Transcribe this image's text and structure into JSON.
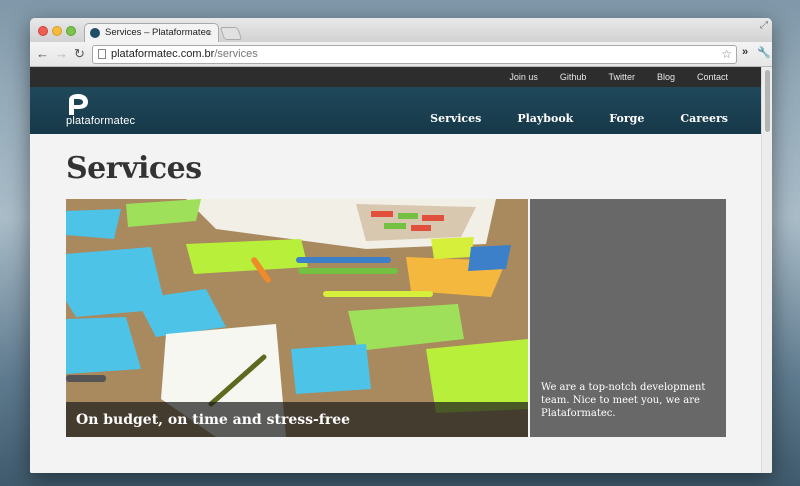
{
  "browser": {
    "tab_title": "Services – Plataformatec",
    "tab_close": "×",
    "url_host": "plataformatec.com.br",
    "url_path": "/services",
    "extensions_label": "»"
  },
  "site": {
    "top_links": [
      "Join us",
      "Github",
      "Twitter",
      "Blog",
      "Contact"
    ],
    "logo_text": "plataformatec",
    "nav_links": [
      "Services",
      "Playbook",
      "Forge",
      "Careers"
    ],
    "brand_colors": {
      "topbar": "#2d2d2d",
      "navbar": "#1b4255",
      "panel": "#686868"
    }
  },
  "main": {
    "title": "Services",
    "hero_caption": "On budget, on time and stress-free",
    "side_text": "We are a top-notch development team. Nice to meet you, we are Plataformatec."
  }
}
